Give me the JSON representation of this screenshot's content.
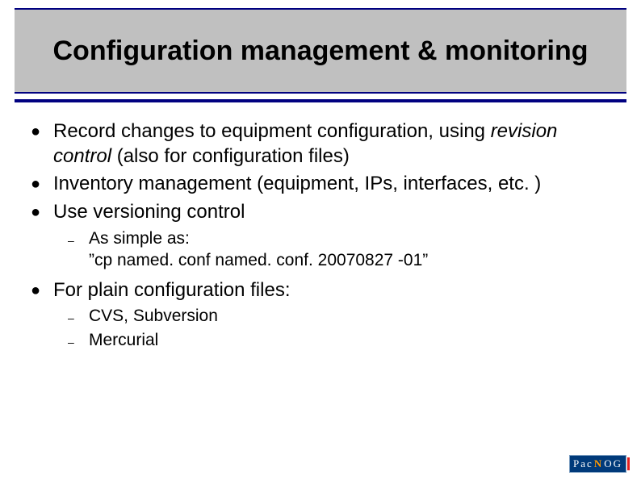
{
  "title": "Configuration management & monitoring",
  "bullets": {
    "b1": {
      "pre": "Record changes to equipment configuration, using ",
      "italic": "revision control",
      "post": " (also for configuration files)"
    },
    "b2": "Inventory management (equipment, IPs, interfaces, etc. )",
    "b3": "Use versioning control",
    "b3a": "As simple as:",
    "b3b": "”cp named. conf named. conf. 20070827 -01”",
    "b4": "For plain configuration files:",
    "b4a": "CVS, Subversion",
    "b4b": "Mercurial"
  },
  "logo": {
    "p": "P",
    "a": "a",
    "c": "c",
    "n": "N",
    "o": "O",
    "g": "G"
  }
}
